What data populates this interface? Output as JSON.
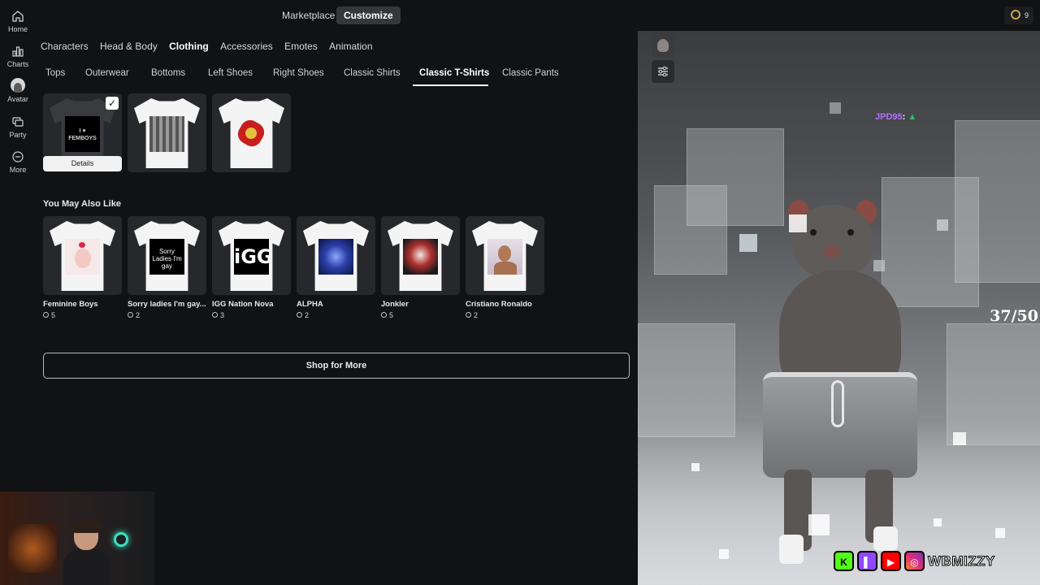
{
  "sidebar": {
    "items": [
      {
        "label": "Home",
        "icon": "home-icon"
      },
      {
        "label": "Charts",
        "icon": "charts-icon"
      },
      {
        "label": "Avatar",
        "icon": "avatar-icon"
      },
      {
        "label": "Party",
        "icon": "party-icon"
      },
      {
        "label": "More",
        "icon": "more-icon"
      }
    ]
  },
  "header": {
    "marketplace": "Marketplace",
    "customize": "Customize",
    "robux_balance": "9"
  },
  "category_tabs": [
    "Characters",
    "Head & Body",
    "Clothing",
    "Accessories",
    "Emotes",
    "Animation"
  ],
  "active_category": "Clothing",
  "sub_tabs": [
    "Tops",
    "Outerwear",
    "Bottoms",
    "Left Shoes",
    "Right Shoes",
    "Classic Shirts",
    "Classic T-Shirts",
    "Classic Pants"
  ],
  "active_sub_tab": "Classic T-Shirts",
  "owned_items": [
    {
      "decal_text": "I ♥ FEMBOYS",
      "selected": true
    },
    {
      "decal_text": "",
      "selected": false
    },
    {
      "decal_text": "",
      "selected": false
    }
  ],
  "details_label": "Details",
  "recommendations": {
    "title": "You May Also Like",
    "items": [
      {
        "name": "Feminine Boys",
        "price": "5"
      },
      {
        "name": "Sorry ladies I'm gay...",
        "price": "2",
        "decal_text": "Sorry Ladies I'm gay"
      },
      {
        "name": "IGG Nation Nova",
        "price": "3",
        "decal_text": "iGG"
      },
      {
        "name": "ALPHA",
        "price": "2"
      },
      {
        "name": "Jonkler",
        "price": "5"
      },
      {
        "name": "Cristiano Ronaldo",
        "price": "2"
      }
    ]
  },
  "shop_more_label": "Shop for More",
  "preview": {
    "chat_username": "JPD95",
    "chat_suffix": ":",
    "counter": "37/50",
    "social_handle": "WBMIZZY",
    "social_icons": [
      "kick-icon",
      "twitch-icon",
      "youtube-icon",
      "instagram-icon"
    ]
  },
  "colors": {
    "background": "#111214",
    "accent_text": "#ffffff",
    "chat_name": "#b072ff"
  }
}
